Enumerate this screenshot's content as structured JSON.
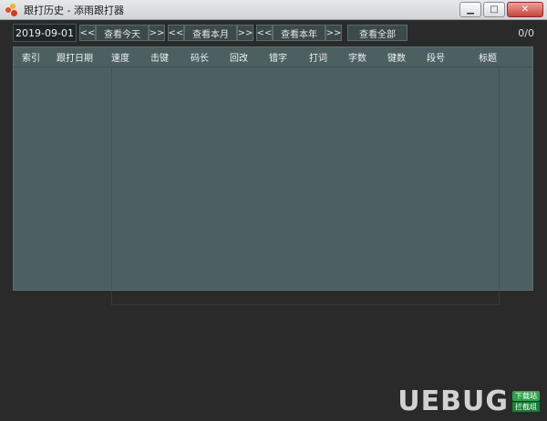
{
  "window": {
    "title": "跟打历史 - 添雨跟打器",
    "min_icon": "minimize-icon",
    "max_icon": "maximize-icon",
    "close_icon": "close-icon",
    "min_glyph": "▁",
    "max_glyph": "□",
    "close_glyph": "✕"
  },
  "toolbar": {
    "date": "2019-09-01",
    "prev": "<<",
    "next": ">>",
    "view_today": "查看今天",
    "view_month": "查看本月",
    "view_year": "查看本年",
    "view_all": "查看全部",
    "count": "0/0"
  },
  "table": {
    "columns": [
      "索引",
      "跟打日期",
      "速度",
      "击键",
      "码长",
      "回改",
      "错字",
      "打词",
      "字数",
      "键数",
      "段号",
      "标题"
    ],
    "rows": []
  },
  "watermark": {
    "logo": "UEBUG",
    "badge_top": "下载站",
    "badge_bottom": "拦截组"
  },
  "colors": {
    "panel": "#4c6062",
    "background": "#2a2a2a",
    "button": "#3c4a4c",
    "close": "#c9433a"
  }
}
